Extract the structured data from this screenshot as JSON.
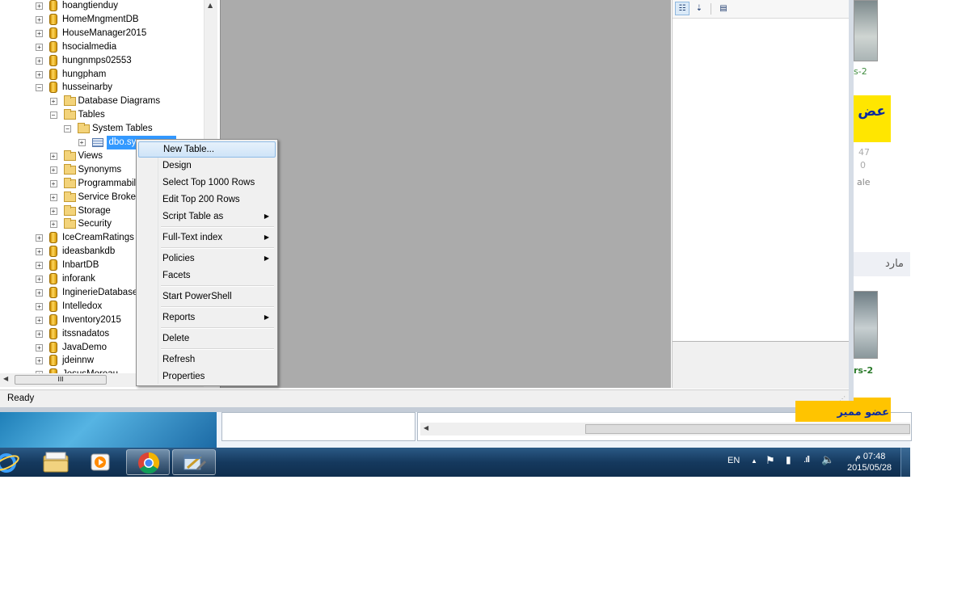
{
  "tree": {
    "databases_top": [
      {
        "label": "hoangtienduy"
      },
      {
        "label": "HomeMngmentDB"
      },
      {
        "label": "HouseManager2015"
      },
      {
        "label": "hsocialmedia"
      },
      {
        "label": "hungnmps02553"
      },
      {
        "label": "hungpham"
      },
      {
        "label": "husseinarby"
      }
    ],
    "husseinarby_children": {
      "database_diagrams": "Database Diagrams",
      "tables": "Tables",
      "system_tables": "System Tables",
      "selected_table": "dbo.sys",
      "views": "Views",
      "synonyms": "Synonyms",
      "programmability": "Programmabil",
      "service_broker": "Service Broker",
      "storage": "Storage",
      "security": "Security"
    },
    "databases_bottom": [
      {
        "label": "IceCreamRatings"
      },
      {
        "label": "ideasbankdb"
      },
      {
        "label": "InbartDB"
      },
      {
        "label": "inforank"
      },
      {
        "label": "InginerieDatabase"
      },
      {
        "label": "Intelledox"
      },
      {
        "label": "Inventory2015"
      },
      {
        "label": "itssnadatos"
      },
      {
        "label": "JavaDemo"
      },
      {
        "label": "jdeinnw"
      },
      {
        "label": "JesusMoreau"
      }
    ],
    "hscroll_grip": "III"
  },
  "context_menu": {
    "items": [
      {
        "label": "New Table...",
        "submenu": false
      },
      {
        "label": "Design",
        "submenu": false
      },
      {
        "label": "Select Top 1000 Rows",
        "submenu": false
      },
      {
        "label": "Edit Top 200 Rows",
        "submenu": false
      },
      {
        "label": "Script Table as",
        "submenu": true
      },
      {
        "label": "Full-Text index",
        "submenu": true
      },
      {
        "label": "Policies",
        "submenu": true
      },
      {
        "label": "Facets",
        "submenu": false
      },
      {
        "label": "Start PowerShell",
        "submenu": false
      },
      {
        "label": "Reports",
        "submenu": true
      },
      {
        "label": "Delete",
        "submenu": false
      },
      {
        "label": "Refresh",
        "submenu": false
      },
      {
        "label": "Properties",
        "submenu": false
      }
    ],
    "highlighted_index": 0
  },
  "status_bar": {
    "text": "Ready"
  },
  "web_strip": {
    "caption1": "s-2",
    "banner1": "عض",
    "n1": "47",
    "n2": "0",
    "t1": "ale",
    "tab": "مارد",
    "caption2": "rs-2",
    "banner2": "عضو ممير"
  },
  "taskbar": {
    "language": "EN",
    "time": "07:48 م",
    "date": "2015/05/28"
  }
}
